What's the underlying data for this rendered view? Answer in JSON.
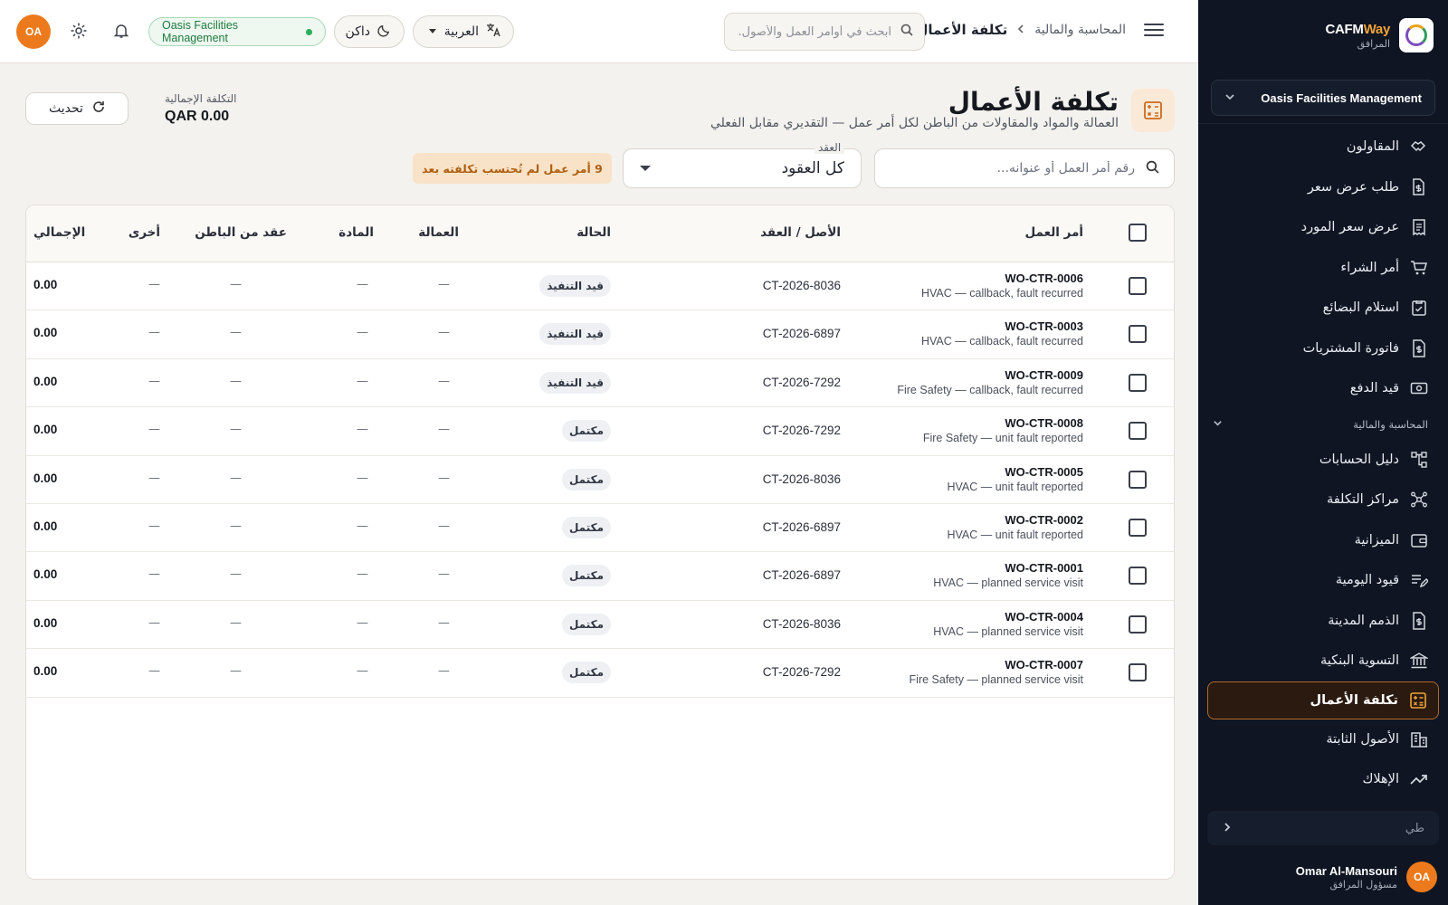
{
  "brand": {
    "name_main": "CAFM",
    "name_accent": "Way",
    "subtitle": "المرافق"
  },
  "sidebar": {
    "org": "Oasis Facilities Management",
    "items_top": [
      {
        "label": "المقاولون",
        "icon": "handshake-icon"
      },
      {
        "label": "طلب عرض سعر",
        "icon": "dollar-doc-icon"
      },
      {
        "label": "عرض سعر المورد",
        "icon": "receipt-icon"
      },
      {
        "label": "أمر الشراء",
        "icon": "cart-icon"
      },
      {
        "label": "استلام البضائع",
        "icon": "checklist-icon"
      },
      {
        "label": "فاتورة المشتريات",
        "icon": "invoice-icon"
      },
      {
        "label": "قيد الدفع",
        "icon": "cash-icon"
      }
    ],
    "section_label": "المحاسبة والمالية",
    "items_bottom": [
      {
        "label": "دليل الحسابات",
        "icon": "hierarchy-icon"
      },
      {
        "label": "مراكز التكلفة",
        "icon": "network-icon"
      },
      {
        "label": "الميزانية",
        "icon": "wallet-icon"
      },
      {
        "label": "قيود اليومية",
        "icon": "journal-icon"
      },
      {
        "label": "الذمم المدينة",
        "icon": "receivable-icon"
      },
      {
        "label": "التسوية البنكية",
        "icon": "bank-icon"
      },
      {
        "label": "تكلفة الأعمال",
        "icon": "calculator-icon",
        "active": true
      },
      {
        "label": "الأصول الثابتة",
        "icon": "building-icon"
      },
      {
        "label": "الإهلاك",
        "icon": "trend-icon"
      }
    ],
    "collapse_placeholder": "طي",
    "user": {
      "initials": "OA",
      "name": "Omar Al-Mansouri",
      "role": "مسؤول المرافق"
    }
  },
  "topbar": {
    "breadcrumb_parent": "المحاسبة والمالية",
    "breadcrumb_current": "تكلفة الأعمال",
    "search_placeholder": "ابحث في أوامر العمل والأصول...",
    "language": "العربية",
    "theme": "داكن",
    "org_badge": "Oasis Facilities Management",
    "avatar_initials": "OA"
  },
  "header": {
    "title": "تكلفة الأعمال",
    "subtitle": "العمالة والمواد والمقاولات من الباطن لكل أمر عمل — التقديري مقابل الفعلي",
    "total_label": "التكلفة الإجمالية",
    "total_value": "QAR 0.00",
    "refresh_label": "تحديث"
  },
  "filters": {
    "search_placeholder": "رقم أمر العمل أو عنوانه...",
    "contract_label": "العقد",
    "contract_value": "كل العقود",
    "uncosted_badge": "9 أمر عمل لم تُحتسب تكلفته بعد"
  },
  "table": {
    "columns": {
      "work_order": "أمر العمل",
      "asset_contract": "الأصل / العقد",
      "status": "الحالة",
      "labor": "العمالة",
      "material": "المادة",
      "subcontract": "عقد من الباطن",
      "other": "أخرى",
      "total": "الإجمالي"
    },
    "rows": [
      {
        "code": "WO-CTR-0006",
        "desc": "HVAC — callback, fault recurred",
        "contract": "CT-2026-8036",
        "status": "قيد التنفيذ",
        "labor": "—",
        "material": "—",
        "subcontract": "—",
        "other": "—",
        "total": "0.00"
      },
      {
        "code": "WO-CTR-0003",
        "desc": "HVAC — callback, fault recurred",
        "contract": "CT-2026-6897",
        "status": "قيد التنفيذ",
        "labor": "—",
        "material": "—",
        "subcontract": "—",
        "other": "—",
        "total": "0.00"
      },
      {
        "code": "WO-CTR-0009",
        "desc": "Fire Safety — callback, fault recurred",
        "contract": "CT-2026-7292",
        "status": "قيد التنفيذ",
        "labor": "—",
        "material": "—",
        "subcontract": "—",
        "other": "—",
        "total": "0.00"
      },
      {
        "code": "WO-CTR-0008",
        "desc": "Fire Safety — unit fault reported",
        "contract": "CT-2026-7292",
        "status": "مكتمل",
        "labor": "—",
        "material": "—",
        "subcontract": "—",
        "other": "—",
        "total": "0.00"
      },
      {
        "code": "WO-CTR-0005",
        "desc": "HVAC — unit fault reported",
        "contract": "CT-2026-8036",
        "status": "مكتمل",
        "labor": "—",
        "material": "—",
        "subcontract": "—",
        "other": "—",
        "total": "0.00"
      },
      {
        "code": "WO-CTR-0002",
        "desc": "HVAC — unit fault reported",
        "contract": "CT-2026-6897",
        "status": "مكتمل",
        "labor": "—",
        "material": "—",
        "subcontract": "—",
        "other": "—",
        "total": "0.00"
      },
      {
        "code": "WO-CTR-0001",
        "desc": "HVAC — planned service visit",
        "contract": "CT-2026-6897",
        "status": "مكتمل",
        "labor": "—",
        "material": "—",
        "subcontract": "—",
        "other": "—",
        "total": "0.00"
      },
      {
        "code": "WO-CTR-0004",
        "desc": "HVAC — planned service visit",
        "contract": "CT-2026-8036",
        "status": "مكتمل",
        "labor": "—",
        "material": "—",
        "subcontract": "—",
        "other": "—",
        "total": "0.00"
      },
      {
        "code": "WO-CTR-0007",
        "desc": "Fire Safety — planned service visit",
        "contract": "CT-2026-7292",
        "status": "مكتمل",
        "labor": "—",
        "material": "—",
        "subcontract": "—",
        "other": "—",
        "total": "0.00"
      }
    ]
  },
  "colors": {
    "accent": "#ec7a1c",
    "sidebar_bg": "#0f1522",
    "success": "#2cae5a",
    "warning_bg": "#f9e3c8",
    "warning_text": "#b05f10"
  }
}
